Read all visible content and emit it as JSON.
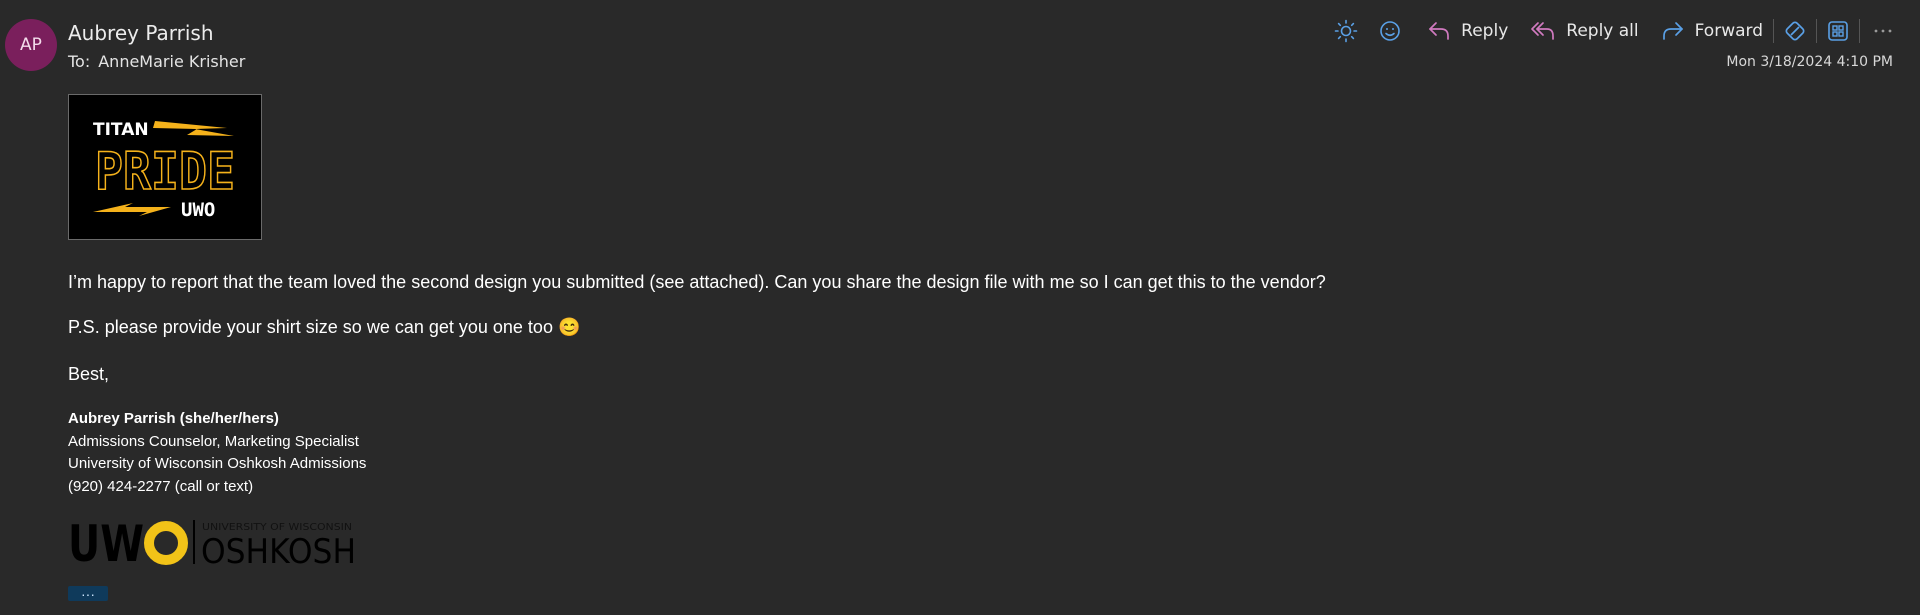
{
  "message": {
    "avatar_initials": "AP",
    "sender_name": "Aubrey Parrish",
    "to_label": "To:",
    "to_name": "AnneMarie Krisher",
    "timestamp": "Mon 3/18/2024 4:10 PM"
  },
  "toolbar": {
    "reply": "Reply",
    "reply_all": "Reply all",
    "forward": "Forward",
    "icons": [
      "sun-icon",
      "emoji-icon",
      "reply-icon",
      "reply-all-icon",
      "forward-icon",
      "loop-icon",
      "apps-icon",
      "more-icon"
    ]
  },
  "image": {
    "top_text": "TITAN",
    "main_text": "PRIDE",
    "bottom_text": "UWO",
    "accent": "#f5b21b"
  },
  "body": {
    "paragraph1": "I’m happy to report that the team loved the second design you submitted (see attached). Can you share the design file with me so I can get this to the vendor?",
    "paragraph2": "P.S. please provide your shirt size so we can get you one too 😊",
    "closing": "Best,"
  },
  "signature": {
    "name": "Aubrey Parrish (she/her/hers)",
    "title": "Admissions Counselor, Marketing Specialist",
    "org": "University of Wisconsin Oshkosh Admissions",
    "phone": "(920) 424-2277 (call or text)"
  },
  "logo": {
    "mark": "UWO",
    "small_text": "UNIVERSITY OF WISCONSIN",
    "big_text": "OSHKOSH",
    "gold": "#f2c318"
  },
  "more_label": "···"
}
